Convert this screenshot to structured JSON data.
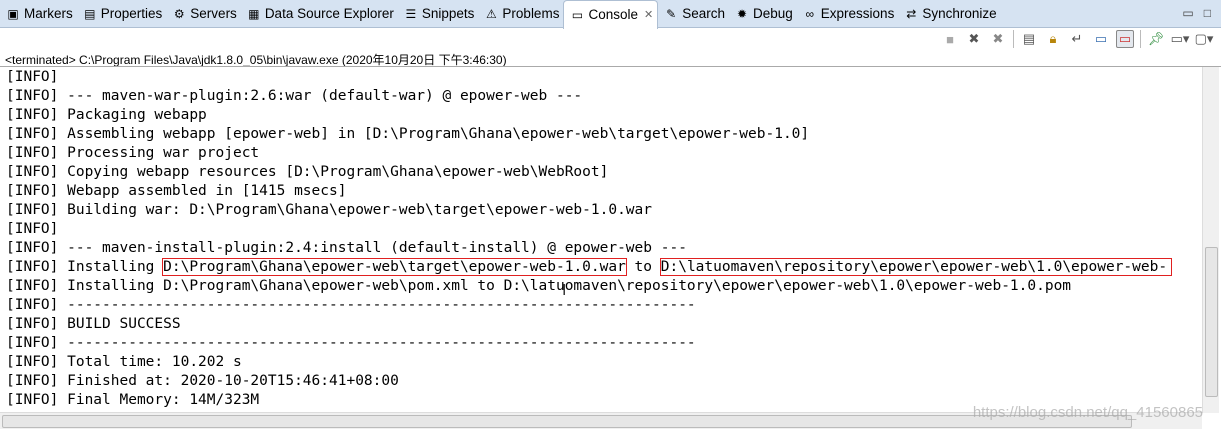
{
  "tabs": [
    {
      "label": "Markers",
      "icon": "markers-icon",
      "glyph": "▣"
    },
    {
      "label": "Properties",
      "icon": "properties-icon",
      "glyph": "▤"
    },
    {
      "label": "Servers",
      "icon": "servers-icon",
      "glyph": "⚙"
    },
    {
      "label": "Data Source Explorer",
      "icon": "data-source-icon",
      "glyph": "▦"
    },
    {
      "label": "Snippets",
      "icon": "snippets-icon",
      "glyph": "☰"
    },
    {
      "label": "Problems",
      "icon": "problems-icon",
      "glyph": "⚠"
    },
    {
      "label": "Console",
      "icon": "console-icon",
      "glyph": "▭",
      "active": true
    },
    {
      "label": "Search",
      "icon": "search-icon",
      "glyph": "✎"
    },
    {
      "label": "Debug",
      "icon": "debug-icon",
      "glyph": "✹"
    },
    {
      "label": "Expressions",
      "icon": "expressions-icon",
      "glyph": "∞"
    },
    {
      "label": "Synchronize",
      "icon": "synchronize-icon",
      "glyph": "⇄"
    }
  ],
  "status": "<terminated> C:\\Program Files\\Java\\jdk1.8.0_05\\bin\\javaw.exe (2020年10月20日 下午3:46:30)",
  "lines": [
    "[INFO]",
    "[INFO] --- maven-war-plugin:2.6:war (default-war) @ epower-web ---",
    "[INFO] Packaging webapp",
    "[INFO] Assembling webapp [epower-web] in [D:\\Program\\Ghana\\epower-web\\target\\epower-web-1.0]",
    "[INFO] Processing war project",
    "[INFO] Copying webapp resources [D:\\Program\\Ghana\\epower-web\\WebRoot]",
    "[INFO] Webapp assembled in [1415 msecs]",
    "[INFO] Building war: D:\\Program\\Ghana\\epower-web\\target\\epower-web-1.0.war",
    "[INFO]",
    "[INFO] --- maven-install-plugin:2.4:install (default-install) @ epower-web ---"
  ],
  "install_line": {
    "prefix": "[INFO] Installing ",
    "source": "D:\\Program\\Ghana\\epower-web\\target\\epower-web-1.0.war",
    "mid": " to ",
    "dest": "D:\\latuomaven\\repository\\epower\\epower-web\\1.0\\epower-web-"
  },
  "lines2": [
    "[INFO] Installing D:\\Program\\Ghana\\epower-web\\pom.xml to D:\\latuomaven\\repository\\epower\\epower-web\\1.0\\epower-web-1.0.pom",
    "[INFO] ------------------------------------------------------------------------",
    "[INFO] BUILD SUCCESS",
    "[INFO] ------------------------------------------------------------------------",
    "[INFO] Total time: 10.202 s",
    "[INFO] Finished at: 2020-10-20T15:46:41+08:00",
    "[INFO] Final Memory: 14M/323M"
  ],
  "watermark": "https://blog.csdn.net/qq_41560865",
  "highlight_color": "#e02020"
}
